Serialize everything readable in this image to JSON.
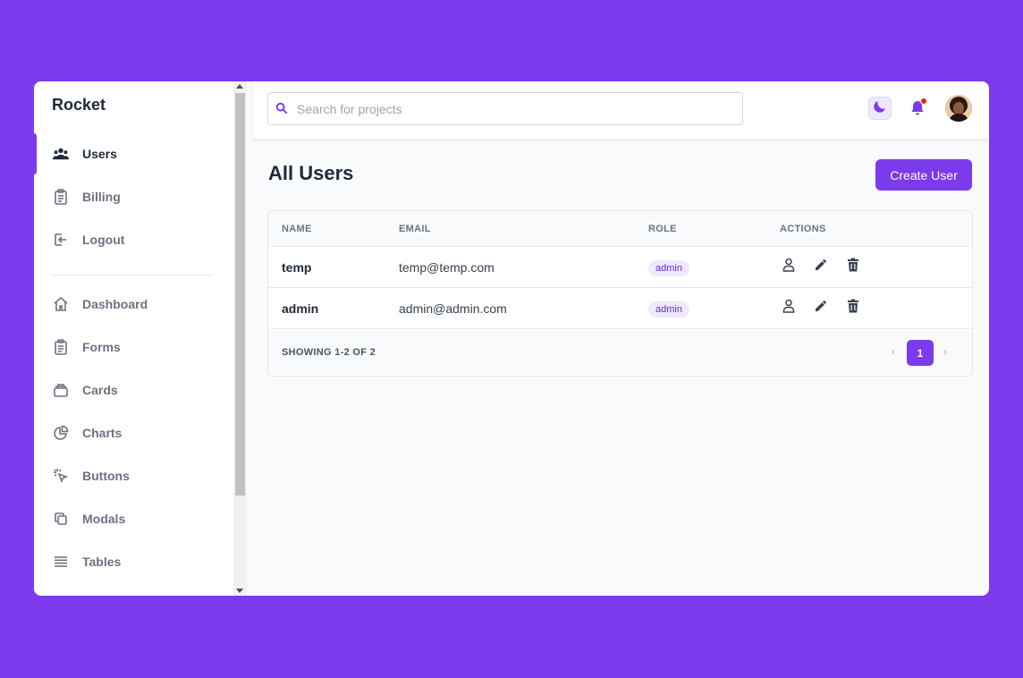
{
  "brand": "Rocket",
  "sidebar": {
    "primary": [
      {
        "label": "Users",
        "icon": "users-icon",
        "active": true
      },
      {
        "label": "Billing",
        "icon": "clipboard-icon"
      },
      {
        "label": "Logout",
        "icon": "logout-icon"
      }
    ],
    "secondary": [
      {
        "label": "Dashboard",
        "icon": "home-icon"
      },
      {
        "label": "Forms",
        "icon": "clipboard-icon"
      },
      {
        "label": "Cards",
        "icon": "card-icon"
      },
      {
        "label": "Charts",
        "icon": "pie-chart-icon"
      },
      {
        "label": "Buttons",
        "icon": "cursor-click-icon"
      },
      {
        "label": "Modals",
        "icon": "duplicate-icon"
      },
      {
        "label": "Tables",
        "icon": "table-lines-icon"
      }
    ]
  },
  "search": {
    "placeholder": "Search for projects"
  },
  "header": {
    "icons": [
      "moon-icon",
      "bell-icon",
      "avatar"
    ]
  },
  "page": {
    "title": "All Users",
    "create_label": "Create User"
  },
  "table": {
    "columns": [
      "NAME",
      "EMAIL",
      "ROLE",
      "ACTIONS"
    ],
    "rows": [
      {
        "name": "temp",
        "email": "temp@temp.com",
        "role": "admin"
      },
      {
        "name": "admin",
        "email": "admin@admin.com",
        "role": "admin"
      }
    ],
    "showing": "SHOWING 1-2 OF 2",
    "pagination": {
      "prev": "‹",
      "current": "1",
      "next": "›"
    }
  },
  "colors": {
    "accent": "#7c3aed",
    "background": "#7c3aed",
    "notification": "#dc2626"
  }
}
